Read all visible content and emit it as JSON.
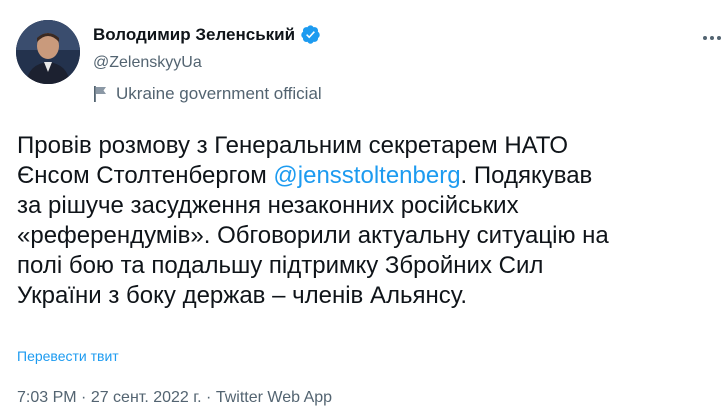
{
  "author": {
    "name": "Володимир Зеленський",
    "handle": "@ZelenskyyUa",
    "label": "Ukraine government official",
    "verified_color": "#1d9bf0"
  },
  "tweet": {
    "lines": [
      {
        "pre": "Провів розмову з Генеральним секретарем НАТО",
        "mention": "",
        "post": ""
      },
      {
        "pre": "Єнсом Столтенбергом ",
        "mention": "@jensstoltenberg",
        "post": ". Подякував"
      },
      {
        "pre": "за рішуче засудження незаконних російських",
        "mention": "",
        "post": ""
      },
      {
        "pre": "«референдумів». Обговорили актуальну ситуацію на",
        "mention": "",
        "post": ""
      },
      {
        "pre": "полі бою та подальшу підтримку Збройних Сил",
        "mention": "",
        "post": ""
      },
      {
        "pre": "України з боку держав – членів Альянсу.",
        "mention": "",
        "post": ""
      }
    ],
    "translate_link": "Перевести твит"
  },
  "meta": {
    "time": "7:03 PM",
    "sep1": " · ",
    "date": "27 сент. 2022 г.",
    "sep2": " · ",
    "source": "Twitter Web App"
  },
  "icons": {
    "avatar": "avatar-photo",
    "verified": "verified-badge-icon",
    "government": "flag-icon",
    "more": "more-icon"
  },
  "colors": {
    "text": "#0f1419",
    "secondary": "#536471",
    "link": "#1d9bf0"
  }
}
